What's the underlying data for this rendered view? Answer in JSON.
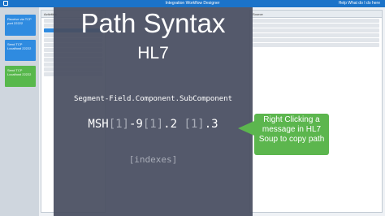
{
  "window": {
    "title": "Integration Workflow Designer",
    "user": "Help  What do I do here"
  },
  "sidebar": {
    "cards": [
      {
        "label": "Receive via TCP port 22222"
      },
      {
        "label": "Send TCP Localhost 22222"
      },
      {
        "label": "Send TCP Localhost 22222"
      }
    ]
  },
  "panes": {
    "left_header": "Activities",
    "right_header": "Source"
  },
  "slide": {
    "title": "Path Syntax",
    "subtitle": "HL7",
    "syntax": "Segment-Field.Component.SubComponent",
    "path_parts": [
      "MSH",
      "[1]",
      "-9",
      "[1]",
      ".2 ",
      "[1]",
      ".3"
    ],
    "indexes_label": "[indexes]"
  },
  "callout": {
    "text": "Right Clicking a message in HL7 Soup to copy path"
  },
  "colors": {
    "overlay": "#484e60",
    "callout": "#5cb64e",
    "titlebar": "#1b73c9",
    "index_gray": "#a9adb8"
  }
}
